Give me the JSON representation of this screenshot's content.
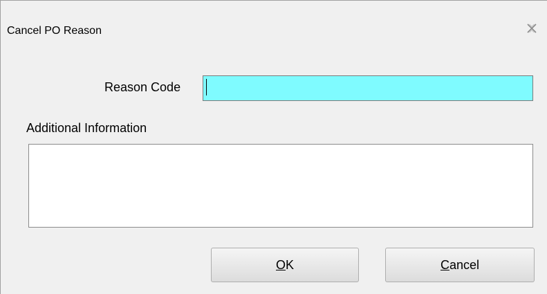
{
  "dialog": {
    "title": "Cancel PO Reason",
    "close_icon": "close-icon"
  },
  "reason_code": {
    "label": "Reason Code",
    "value": "",
    "background": "#7ffbff"
  },
  "additional_information": {
    "label": "Additional Information",
    "value": ""
  },
  "buttons": {
    "ok": {
      "mnemonic": "O",
      "rest": "K"
    },
    "cancel": {
      "mnemonic": "C",
      "rest": "ancel"
    }
  }
}
